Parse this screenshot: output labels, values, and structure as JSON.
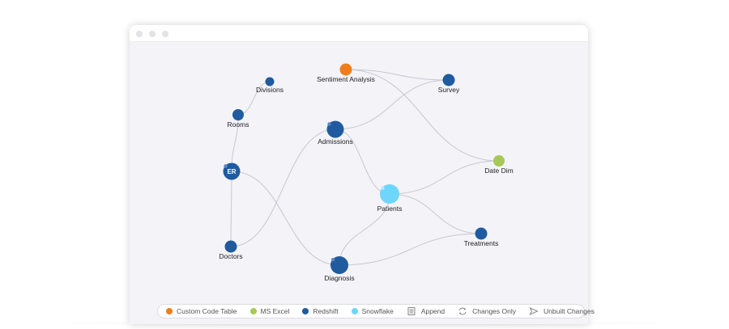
{
  "nodes": [
    {
      "id": "sentiment",
      "label": "Sentiment Analysis",
      "color": "#f07d19",
      "type": "custom-code"
    },
    {
      "id": "survey",
      "label": "Survey",
      "color": "#1f5b9e",
      "type": "redshift"
    },
    {
      "id": "divisions",
      "label": "Divisions",
      "color": "#1f5b9e",
      "type": "redshift"
    },
    {
      "id": "rooms",
      "label": "Rooms",
      "color": "#1f5b9e",
      "type": "redshift"
    },
    {
      "id": "admissions",
      "label": "Admissions",
      "color": "#1f5b9e",
      "type": "redshift"
    },
    {
      "id": "er",
      "label": "ER",
      "color": "#1f5b9e",
      "type": "redshift"
    },
    {
      "id": "datedim",
      "label": "Date Dim",
      "color": "#a7c957",
      "type": "ms-excel"
    },
    {
      "id": "patients",
      "label": "Patients",
      "color": "#6fd6fb",
      "type": "snowflake"
    },
    {
      "id": "doctors",
      "label": "Doctors",
      "color": "#1f5b9e",
      "type": "redshift"
    },
    {
      "id": "treatments",
      "label": "Treatments",
      "color": "#1f5b9e",
      "type": "redshift"
    },
    {
      "id": "diagnosis",
      "label": "Diagnosis",
      "color": "#1f5b9e",
      "type": "redshift"
    }
  ],
  "edges": [
    {
      "from": "sentiment",
      "to": "survey"
    },
    {
      "from": "sentiment",
      "to": "datedim"
    },
    {
      "from": "divisions",
      "to": "rooms"
    },
    {
      "from": "rooms",
      "to": "er"
    },
    {
      "from": "admissions",
      "to": "survey"
    },
    {
      "from": "admissions",
      "to": "patients"
    },
    {
      "from": "admissions",
      "to": "doctors"
    },
    {
      "from": "er",
      "to": "doctors"
    },
    {
      "from": "er",
      "to": "diagnosis"
    },
    {
      "from": "patients",
      "to": "datedim"
    },
    {
      "from": "patients",
      "to": "diagnosis"
    },
    {
      "from": "patients",
      "to": "treatments"
    },
    {
      "from": "diagnosis",
      "to": "treatments"
    }
  ],
  "legend": {
    "items": [
      {
        "label": "Custom Code Table",
        "color": "#f07d19",
        "icon": "orange-dot-icon"
      },
      {
        "label": "MS Excel",
        "color": "#a7c957",
        "icon": "green-dot-icon"
      },
      {
        "label": "Redshift",
        "color": "#1f5b9e",
        "icon": "blue-dot-icon"
      },
      {
        "label": "Snowflake",
        "color": "#6fd6fb",
        "icon": "light-blue-dot-icon"
      },
      {
        "label": "Append",
        "icon": "append-icon"
      },
      {
        "label": "Changes Only",
        "icon": "changes-only-icon"
      },
      {
        "label": "Unbuilt Changes",
        "icon": "unbuilt-changes-icon"
      }
    ]
  },
  "colors": {
    "edge": "#c9c8d2",
    "window_bg": "#f4f3f8",
    "label": "#222222"
  }
}
